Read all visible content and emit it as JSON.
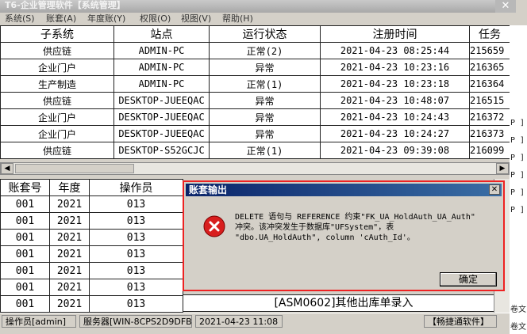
{
  "window": {
    "title": "T6-企业管理软件【系统管理】",
    "close_glyph": "✕"
  },
  "menu": [
    {
      "label": "系统(S)"
    },
    {
      "label": "账套(A)"
    },
    {
      "label": "年度账(Y)"
    },
    {
      "label": "权限(O)"
    },
    {
      "label": "视图(V)"
    },
    {
      "label": "帮助(H)"
    }
  ],
  "top_table": {
    "headers": [
      "子系统",
      "站点",
      "运行状态",
      "注册时间",
      "任务"
    ],
    "rows": [
      [
        "供应链",
        "ADMIN-PC",
        "正常(2)",
        "2021-04-23 08:25:44",
        "215659"
      ],
      [
        "企业门户",
        "ADMIN-PC",
        "异常",
        "2021-04-23 10:23:16",
        "216365"
      ],
      [
        "生产制造",
        "ADMIN-PC",
        "正常(1)",
        "2021-04-23 10:23:18",
        "216364"
      ],
      [
        "供应链",
        "DESKTOP-JUEEQAC",
        "异常",
        "2021-04-23 10:48:07",
        "216515"
      ],
      [
        "企业门户",
        "DESKTOP-JUEEQAC",
        "异常",
        "2021-04-23 10:24:43",
        "216372"
      ],
      [
        "企业门户",
        "DESKTOP-JUEEQAC",
        "异常",
        "2021-04-23 10:24:27",
        "216373"
      ],
      [
        "供应链",
        "DESKTOP-S52GCJC",
        "正常(1)",
        "2021-04-23 09:39:08",
        "216099"
      ]
    ]
  },
  "bottom_table": {
    "headers": [
      "账套号",
      "年度",
      "操作员"
    ],
    "rows": [
      [
        "001",
        "2021",
        "013"
      ],
      [
        "001",
        "2021",
        "013"
      ],
      [
        "001",
        "2021",
        "013"
      ],
      [
        "001",
        "2021",
        "013"
      ],
      [
        "001",
        "2021",
        "013"
      ],
      [
        "001",
        "2021",
        "013"
      ],
      [
        "001",
        "2021",
        "013"
      ]
    ],
    "last_row_function": "[ASM0602]其他出库单录入"
  },
  "dialog": {
    "title": "账套输出",
    "close_glyph": "✕",
    "message_line1": "DELETE 语句与 REFERENCE 约束\"FK_UA_HoldAuth_UA_Auth\"",
    "message_line2": "冲突。该冲突发生于数据库\"UFSystem\"，表",
    "message_line3": "\"dbo.UA_HoldAuth\", column 'cAuth_Id'。",
    "ok_label": "确定",
    "accent": "#ee2222"
  },
  "statusbar": {
    "operator": "操作员[admin]",
    "server": "服务器[WIN-8CPS2D9DFB9]",
    "datetime": "2021-04-23 11:08",
    "brand": "【畅捷通软件】"
  },
  "right_strip": [
    "P ]",
    "P ]",
    "P ]",
    "P ]",
    "P ]",
    "P ]",
    "卷文",
    "卷文"
  ]
}
